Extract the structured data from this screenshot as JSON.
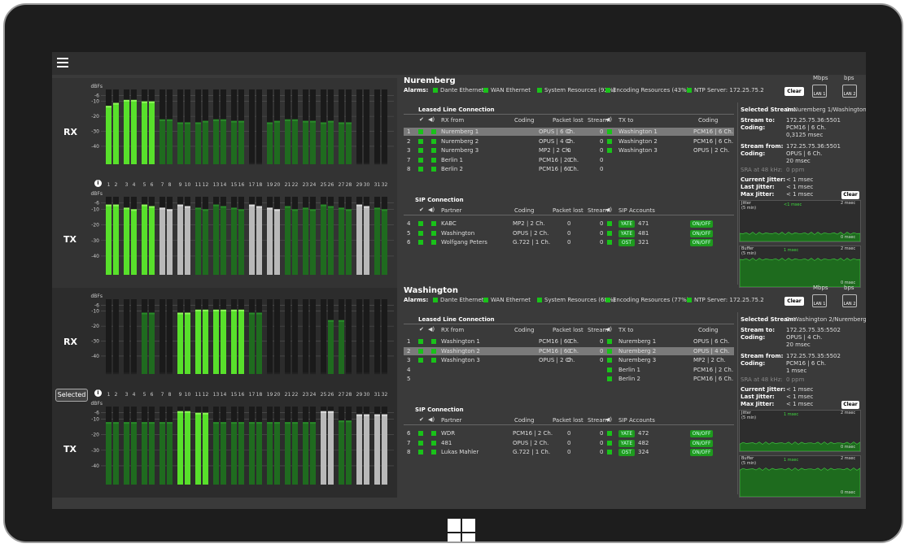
{
  "menu_icon": "hamburger-icon",
  "channels": [
    "1",
    "2",
    "3",
    "4",
    "5",
    "6",
    "7",
    "8",
    "9",
    "10",
    "11",
    "12",
    "13",
    "14",
    "15",
    "16",
    "17",
    "18",
    "19",
    "20",
    "21",
    "22",
    "23",
    "24",
    "25",
    "26",
    "27",
    "28",
    "29",
    "30",
    "31",
    "32"
  ],
  "scale": {
    "dbfs": "dBFs",
    "ticks": [
      "-6",
      "-10",
      "-20",
      "-30",
      "-40"
    ]
  },
  "labels": {
    "rx": "RX",
    "tx": "TX",
    "selected": "Selected"
  },
  "headers": {
    "leased": "Leased Line Connection",
    "sip": "SIP Connection",
    "rx_from": "RX from",
    "coding": "Coding",
    "packet_lost": "Packet lost",
    "stream": "Stream",
    "tx_to": "TX to",
    "partner": "Partner",
    "sip_accounts": "SIP Accounts",
    "alarms": "Alarms:",
    "clear": "Clear",
    "mbps": "Mbps",
    "bps": "bps",
    "lan1": "LAN 1",
    "lan2": "LAN 2",
    "onoff": "ON/OFF"
  },
  "panels": [
    {
      "name": "Nuremberg",
      "alarms": [
        "Dante Ethernet",
        "WAN Ethernet",
        "System Resources (92%)",
        "Encoding Resources (43%)",
        "NTP Server: 172.25.75.2"
      ],
      "lan_stats": [
        "3.3.3  7.96",
        "0     0"
      ],
      "leased_rows": [
        {
          "n": "1",
          "rx": "Nuremberg 1",
          "coding": "OPUS | 6 Ch.",
          "lost": "0",
          "stream": "0",
          "tx": "Washington 1",
          "txcoding": "PCM16 | 6 Ch.",
          "hl": true
        },
        {
          "n": "2",
          "rx": "Nuremberg 2",
          "coding": "OPUS | 4 Ch.",
          "lost": "0",
          "stream": "0",
          "tx": "Washington 2",
          "txcoding": "PCM16 | 6 Ch.",
          "hl": false
        },
        {
          "n": "3",
          "rx": "Nuremberg 3",
          "coding": "MP2 | 2 Ch.",
          "lost": "0",
          "stream": "0",
          "tx": "Washington 3",
          "txcoding": "OPUS | 2 Ch.",
          "hl": false
        },
        {
          "n": "7",
          "rx": "Berlin 1",
          "coding": "PCM16 | 2 Ch.",
          "lost": "0",
          "stream": "0",
          "tx": "",
          "txcoding": "",
          "hl": false
        },
        {
          "n": "8",
          "rx": "Berlin 2",
          "coding": "PCM16 | 6 Ch.",
          "lost": "0",
          "stream": "0",
          "tx": "",
          "txcoding": "",
          "hl": false
        }
      ],
      "sip_rows": [
        {
          "n": "4",
          "partner": "KABC",
          "coding": "MP2 | 2 Ch.",
          "lost": "0",
          "stream": "0",
          "acct": "YATE",
          "num": "471"
        },
        {
          "n": "5",
          "partner": "Washington",
          "coding": "OPUS | 2 Ch.",
          "lost": "0",
          "stream": "0",
          "acct": "YATE",
          "num": "481"
        },
        {
          "n": "6",
          "partner": "Wolfgang Peters",
          "coding": "G.722 | 1 Ch.",
          "lost": "0",
          "stream": "0",
          "acct": "OST",
          "num": "321"
        }
      ],
      "detail": {
        "selected_label": "Selected Stream:",
        "selected": "1: Nuremberg 1/Washington 1",
        "stream_to_label": "Stream to:",
        "stream_to": "172.25.75.36:5501",
        "coding_label": "Coding:",
        "coding_to": [
          "PCM16 | 6 Ch.",
          "0,3125 msec"
        ],
        "stream_from_label": "Stream from:",
        "stream_from": "172.25.75.36:5501",
        "coding_from": [
          "OPUS | 6 Ch.",
          "20 msec"
        ],
        "sra_label": "SRA at 48 kHz:",
        "sra": "0 ppm",
        "cur_jitter_label": "Current Jitter:",
        "cur_jitter": "< 1 msec",
        "last_jitter_label": "Last Jitter:",
        "last_jitter": "< 1 msec",
        "max_jitter_label": "Max Jitter:",
        "max_jitter": "< 1 msec",
        "jitter_graph": {
          "title": "Jitter",
          "sub": "(5 min)",
          "mid": "<1 msec",
          "top": "2 msec",
          "bottom": "0 msec"
        },
        "buffer_graph": {
          "title": "Buffer",
          "sub": "(5 min)",
          "mid": "1 msec",
          "top": "2 msec",
          "bottom": "0 msec"
        }
      },
      "rx_levels": [
        0.78,
        0.82,
        0.86,
        0.86,
        0.84,
        0.84,
        0.6,
        0.6,
        0.56,
        0.56,
        0.56,
        0.58,
        0.6,
        0.6,
        0.58,
        0.58,
        0.02,
        0.02,
        0.56,
        0.58,
        0.6,
        0.6,
        0.58,
        0.58,
        0.56,
        0.58,
        0.56,
        0.56,
        0.02,
        0.02,
        0.02,
        0.02
      ],
      "tx_levels": [
        0.9,
        0.9,
        0.86,
        0.84,
        0.9,
        0.88,
        0.86,
        0.84,
        0.9,
        0.88,
        0.86,
        0.84,
        0.9,
        0.88,
        0.86,
        0.84,
        0.9,
        0.88,
        0.86,
        0.84,
        0.88,
        0.84,
        0.86,
        0.84,
        0.9,
        0.88,
        0.86,
        0.84,
        0.9,
        0.88,
        0.86,
        0.84
      ],
      "tx_colors": [
        "hg",
        "hg",
        "hg",
        "hg",
        "hg",
        "hg",
        "w",
        "w",
        "w",
        "w",
        "g",
        "g",
        "g",
        "g",
        "g",
        "g",
        "w",
        "w",
        "w",
        "w",
        "g",
        "g",
        "g",
        "g",
        "g",
        "g",
        "g",
        "g",
        "w",
        "w",
        "g",
        "g"
      ],
      "rx_colors": [
        "hg",
        "hg",
        "hg",
        "hg",
        "hg",
        "hg",
        "g",
        "g",
        "g",
        "g",
        "g",
        "g",
        "g",
        "g",
        "g",
        "g",
        "d",
        "d",
        "g",
        "g",
        "g",
        "g",
        "g",
        "g",
        "g",
        "g",
        "g",
        "g",
        "d",
        "d",
        "d",
        "d"
      ]
    },
    {
      "name": "Washington",
      "alarms": [
        "Dante Ethernet",
        "WAN Ethernet",
        "System Resources (68%)",
        "Encoding Resources (77%)",
        "NTP Server: 172.25.75.2"
      ],
      "lan_stats": [
        "6.42  13.4",
        "0     0"
      ],
      "leased_rows": [
        {
          "n": "1",
          "rx": "Washington 1",
          "coding": "PCM16 | 6 Ch.",
          "lost": "0",
          "stream": "0",
          "tx": "Nuremberg 1",
          "txcoding": "OPUS | 6 Ch.",
          "hl": false
        },
        {
          "n": "2",
          "rx": "Washington 2",
          "coding": "PCM16 | 6 Ch.",
          "lost": "0",
          "stream": "0",
          "tx": "Nuremberg 2",
          "txcoding": "OPUS | 4 Ch.",
          "hl": true
        },
        {
          "n": "3",
          "rx": "Washington 3",
          "coding": "OPUS | 2 Ch.",
          "lost": "0",
          "stream": "0",
          "tx": "Nuremberg 3",
          "txcoding": "MP2 | 2 Ch.",
          "hl": false
        },
        {
          "n": "4",
          "rx": "",
          "coding": "",
          "lost": "",
          "stream": "",
          "tx": "Berlin 1",
          "txcoding": "PCM16 | 2 Ch.",
          "hl": false
        },
        {
          "n": "5",
          "rx": "",
          "coding": "",
          "lost": "",
          "stream": "",
          "tx": "Berlin 2",
          "txcoding": "PCM16 | 6 Ch.",
          "hl": false
        }
      ],
      "sip_rows": [
        {
          "n": "6",
          "partner": "WDR",
          "coding": "PCM16 | 2 Ch.",
          "lost": "0",
          "stream": "0",
          "acct": "YATE",
          "num": "472"
        },
        {
          "n": "7",
          "partner": "481",
          "coding": "OPUS | 2 Ch.",
          "lost": "0",
          "stream": "0",
          "acct": "YATE",
          "num": "482"
        },
        {
          "n": "8",
          "partner": "Lukas Mahler",
          "coding": "G.722 | 1 Ch.",
          "lost": "0",
          "stream": "0",
          "acct": "OST",
          "num": "324"
        }
      ],
      "detail": {
        "selected_label": "Selected Stream:",
        "selected": "2: Washington 2/Nuremberg 2",
        "stream_to_label": "Stream to:",
        "stream_to": "172.25.75.35:5502",
        "coding_label": "Coding:",
        "coding_to": [
          "OPUS | 4 Ch.",
          "20 msec"
        ],
        "stream_from_label": "Stream from:",
        "stream_from": "172.25.75.35:5502",
        "coding_from": [
          "PCM16 | 6 Ch.",
          "1 msec"
        ],
        "sra_label": "SRA at 48 kHz:",
        "sra": "0 ppm",
        "cur_jitter_label": "Current Jitter:",
        "cur_jitter": "< 1 msec",
        "last_jitter_label": "Last Jitter:",
        "last_jitter": "< 1 msec",
        "max_jitter_label": "Max Jitter:",
        "max_jitter": "< 1 msec",
        "jitter_graph": {
          "title": "Jitter",
          "sub": "(5 min)",
          "mid": "1 msec",
          "top": "2 msec",
          "bottom": "0 msec"
        },
        "buffer_graph": {
          "title": "Buffer",
          "sub": "(5 min)",
          "mid": "1 msec",
          "top": "2 msec",
          "bottom": "0 msec"
        }
      },
      "rx_levels": [
        0.02,
        0.02,
        0.02,
        0.02,
        0.82,
        0.82,
        0.02,
        0.02,
        0.82,
        0.82,
        0.86,
        0.86,
        0.86,
        0.86,
        0.86,
        0.86,
        0.82,
        0.82,
        0.02,
        0.02,
        0.02,
        0.02,
        0.02,
        0.02,
        0.02,
        0.72,
        0.72,
        0.02,
        0.02,
        0.02,
        0.02,
        0.02
      ],
      "tx_levels": [
        0.8,
        0.8,
        0.8,
        0.8,
        0.8,
        0.8,
        0.8,
        0.8,
        0.94,
        0.94,
        0.92,
        0.92,
        0.8,
        0.8,
        0.8,
        0.8,
        0.8,
        0.8,
        0.8,
        0.8,
        0.8,
        0.8,
        0.8,
        0.8,
        0.94,
        0.94,
        0.82,
        0.82,
        0.9,
        0.9,
        0.9,
        0.9
      ],
      "tx_colors": [
        "g",
        "g",
        "g",
        "g",
        "g",
        "g",
        "g",
        "g",
        "hg",
        "hg",
        "hg",
        "hg",
        "g",
        "g",
        "g",
        "g",
        "g",
        "g",
        "g",
        "g",
        "g",
        "g",
        "g",
        "g",
        "w",
        "w",
        "g",
        "g",
        "w",
        "w",
        "w",
        "w"
      ],
      "rx_colors": [
        "d",
        "d",
        "d",
        "d",
        "g",
        "g",
        "d",
        "d",
        "hg",
        "hg",
        "hg",
        "hg",
        "hg",
        "hg",
        "hg",
        "hg",
        "g",
        "g",
        "d",
        "d",
        "d",
        "d",
        "d",
        "d",
        "d",
        "g",
        "g",
        "d",
        "d",
        "d",
        "d",
        "d"
      ]
    }
  ]
}
